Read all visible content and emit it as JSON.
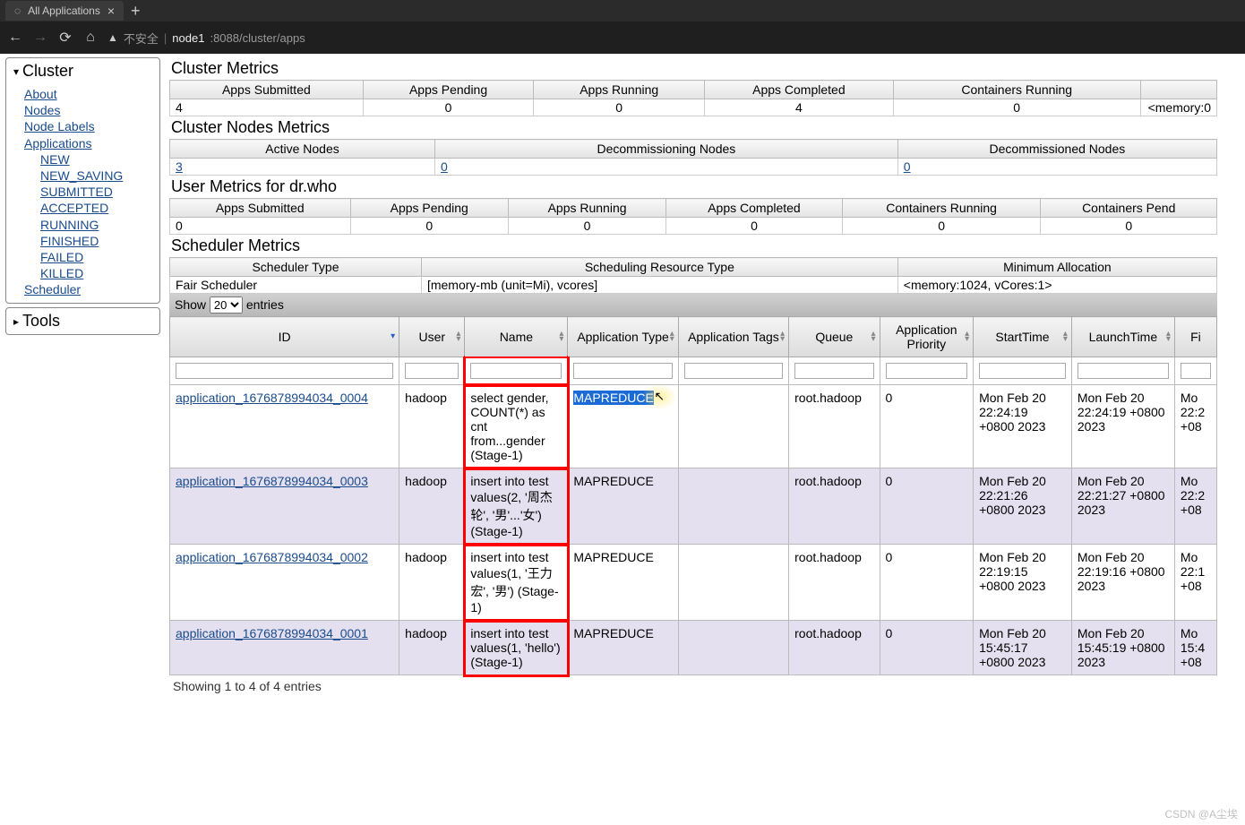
{
  "browser": {
    "tab_title": "All Applications",
    "insecure_label": "不安全",
    "url_host": "node1",
    "url_path": ":8088/cluster/apps"
  },
  "sidebar": {
    "cluster_title": "Cluster",
    "tools_title": "Tools",
    "links": {
      "about": "About",
      "nodes": "Nodes",
      "node_labels": "Node Labels",
      "applications": "Applications",
      "scheduler": "Scheduler"
    },
    "app_states": [
      "NEW",
      "NEW_SAVING",
      "SUBMITTED",
      "ACCEPTED",
      "RUNNING",
      "FINISHED",
      "FAILED",
      "KILLED"
    ]
  },
  "sections": {
    "cluster_metrics": "Cluster Metrics",
    "cluster_nodes_metrics": "Cluster Nodes Metrics",
    "user_metrics": "User Metrics for dr.who",
    "scheduler_metrics": "Scheduler Metrics"
  },
  "cluster_metrics": {
    "headers": [
      "Apps Submitted",
      "Apps Pending",
      "Apps Running",
      "Apps Completed",
      "Containers Running"
    ],
    "values": [
      "4",
      "0",
      "0",
      "4",
      "0"
    ],
    "extra": "<memory:0"
  },
  "nodes_metrics": {
    "headers": [
      "Active Nodes",
      "Decommissioning Nodes",
      "Decommissioned Nodes"
    ],
    "values": [
      "3",
      "0",
      "0"
    ]
  },
  "user_metrics": {
    "headers": [
      "Apps Submitted",
      "Apps Pending",
      "Apps Running",
      "Apps Completed",
      "Containers Running",
      "Containers Pend"
    ],
    "values": [
      "0",
      "0",
      "0",
      "0",
      "0",
      "0"
    ]
  },
  "scheduler_metrics": {
    "headers": [
      "Scheduler Type",
      "Scheduling Resource Type",
      "Minimum Allocation"
    ],
    "values": [
      "Fair Scheduler",
      "[memory-mb (unit=Mi), vcores]",
      "<memory:1024, vCores:1>"
    ]
  },
  "entries": {
    "show": "Show",
    "count": "20",
    "suffix": "entries"
  },
  "apps_table": {
    "headers": [
      "ID",
      "User",
      "Name",
      "Application Type",
      "Application Tags",
      "Queue",
      "Application Priority",
      "StartTime",
      "LaunchTime",
      "Fi"
    ],
    "rows": [
      {
        "id": "application_1676878994034_0004",
        "user": "hadoop",
        "name": "select gender, COUNT(*) as cnt from...gender (Stage-1)",
        "type": "MAPREDUCE",
        "tags": "",
        "queue": "root.hadoop",
        "priority": "0",
        "start": "Mon Feb 20 22:24:19 +0800 2023",
        "launch": "Mon Feb 20 22:24:19 +0800 2023",
        "finish": "Mo 22:2 +08"
      },
      {
        "id": "application_1676878994034_0003",
        "user": "hadoop",
        "name": "insert into test values(2, '周杰轮', '男'...'女') (Stage-1)",
        "type": "MAPREDUCE",
        "tags": "",
        "queue": "root.hadoop",
        "priority": "0",
        "start": "Mon Feb 20 22:21:26 +0800 2023",
        "launch": "Mon Feb 20 22:21:27 +0800 2023",
        "finish": "Mo 22:2 +08"
      },
      {
        "id": "application_1676878994034_0002",
        "user": "hadoop",
        "name": "insert into test values(1, '王力宏', '男') (Stage-1)",
        "type": "MAPREDUCE",
        "tags": "",
        "queue": "root.hadoop",
        "priority": "0",
        "start": "Mon Feb 20 22:19:15 +0800 2023",
        "launch": "Mon Feb 20 22:19:16 +0800 2023",
        "finish": "Mo 22:1 +08"
      },
      {
        "id": "application_1676878994034_0001",
        "user": "hadoop",
        "name": "insert into test values(1, 'hello') (Stage-1)",
        "type": "MAPREDUCE",
        "tags": "",
        "queue": "root.hadoop",
        "priority": "0",
        "start": "Mon Feb 20 15:45:17 +0800 2023",
        "launch": "Mon Feb 20 15:45:19 +0800 2023",
        "finish": "Mo 15:4 +08"
      }
    ]
  },
  "footer": "Showing 1 to 4 of 4 entries",
  "watermark": "CSDN @A尘埃"
}
